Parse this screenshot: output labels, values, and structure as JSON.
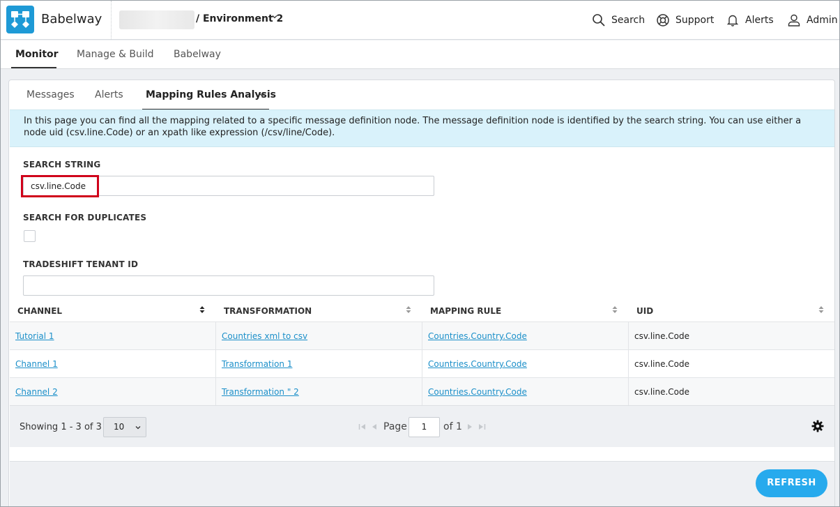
{
  "header": {
    "app_title": "Babelway",
    "environment": "/ Environment 2",
    "actions": {
      "search": "Search",
      "support": "Support",
      "alerts": "Alerts",
      "admin": "Admin"
    }
  },
  "main_nav": {
    "tabs": [
      "Monitor",
      "Manage & Build",
      "Babelway"
    ],
    "active": "Monitor"
  },
  "sub_nav": {
    "tabs": [
      "Messages",
      "Alerts",
      "Mapping Rules Analysis"
    ],
    "active": "Mapping Rules Analysis"
  },
  "info_text": "In this page you can find all the mapping related to a specific message definition node. The message definition node is identified by the search string. You can use either a node uid (csv.line.Code) or an xpath like expression (/csv/line/Code).",
  "form": {
    "search_string_label": "SEARCH STRING",
    "search_string_value": "csv.line.Code",
    "duplicates_label": "SEARCH FOR DUPLICATES",
    "tenant_label": "TRADESHIFT TENANT ID",
    "tenant_value": ""
  },
  "table": {
    "columns": [
      "CHANNEL",
      "TRANSFORMATION",
      "MAPPING RULE",
      "UID"
    ],
    "rows": [
      {
        "channel": "Tutorial 1",
        "transformation": "Countries xml to csv",
        "mapping_rule": "Countries.Country.Code",
        "uid": "csv.line.Code"
      },
      {
        "channel": "Channel 1",
        "transformation": "Transformation 1",
        "mapping_rule": "Countries.Country.Code",
        "uid": "csv.line.Code"
      },
      {
        "channel": "Channel 2",
        "transformation": "Transformation \" 2",
        "mapping_rule": "Countries.Country.Code",
        "uid": "csv.line.Code"
      }
    ]
  },
  "pager": {
    "showing": "Showing 1 - 3 of 3",
    "page_size": "10",
    "page_label": "Page",
    "page_value": "1",
    "of_label": "of 1"
  },
  "refresh_label": "REFRESH",
  "colors": {
    "accent": "#27aaed",
    "link": "#1b8fc9",
    "info_bg": "#d9f2fb",
    "highlight": "#d0021b",
    "logo": "#1e9ad6"
  }
}
